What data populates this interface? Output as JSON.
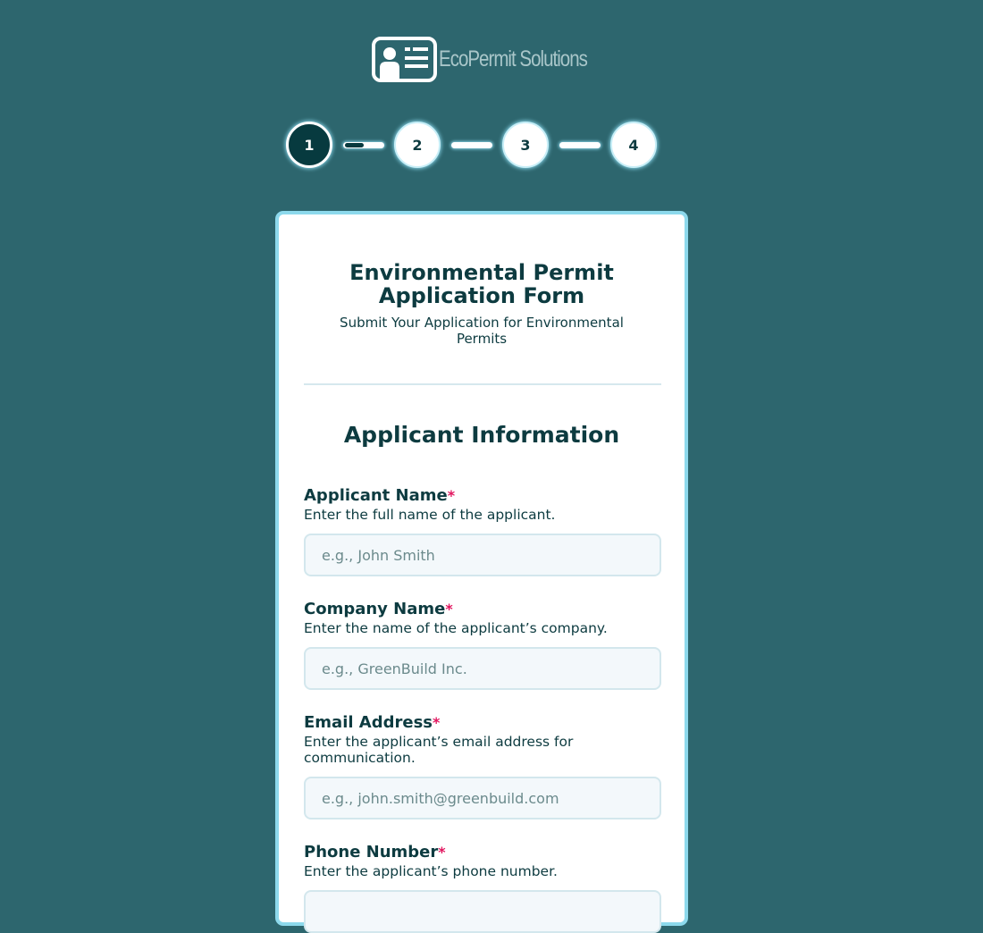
{
  "brand": {
    "name": "EcoPermit Solutions",
    "icon": "id-card-icon"
  },
  "stepper": {
    "current_step": 1,
    "steps": [
      {
        "label": "1",
        "state": "active"
      },
      {
        "label": "2",
        "state": "pending"
      },
      {
        "label": "3",
        "state": "pending"
      },
      {
        "label": "4",
        "state": "pending"
      }
    ],
    "connector_progress": [
      0.5,
      0,
      0
    ]
  },
  "form": {
    "title": "Environmental Permit Application Form",
    "subtitle": "Submit Your Application for Environmental Permits",
    "section_title": "Applicant Information",
    "fields": [
      {
        "label": "Applicant Name",
        "required_marker": "*",
        "help": "Enter the full name of the applicant.",
        "placeholder": "e.g., John Smith",
        "value": ""
      },
      {
        "label": "Company Name",
        "required_marker": "*",
        "help": "Enter the name of the applicant’s company.",
        "placeholder": "e.g., GreenBuild Inc.",
        "value": ""
      },
      {
        "label": "Email Address",
        "required_marker": "*",
        "help": "Enter the applicant’s email address for communication.",
        "placeholder": "e.g., john.smith@greenbuild.com",
        "value": ""
      },
      {
        "label": "Phone Number",
        "required_marker": "*",
        "help": "Enter the applicant’s phone number.",
        "placeholder": "",
        "value": ""
      }
    ]
  },
  "colors": {
    "background": "#2d666e",
    "primary_dark": "#073a3f",
    "accent_border": "#8dd9ec",
    "required": "#e2165f",
    "text": "#0d3b40"
  }
}
